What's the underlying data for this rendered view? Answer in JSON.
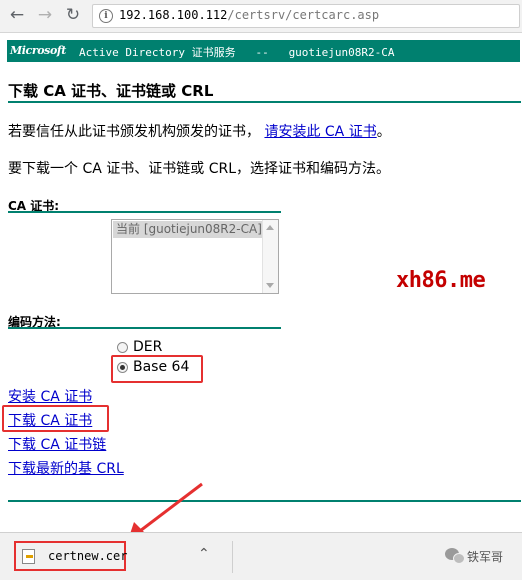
{
  "browser": {
    "url_host": "192.168.100.112",
    "url_path": "/certsrv/certcarc.asp"
  },
  "banner": {
    "brand": "Microsoft",
    "text": "Active Directory 证书服务   --   guotiejun08R2-CA"
  },
  "page": {
    "title": "下载 CA 证书、证书链或 CRL",
    "trust_text": "若要信任从此证书颁发机构颁发的证书，",
    "trust_link": "请安装此 CA 证书",
    "trust_end": "。",
    "instruction": "要下载一个 CA 证书、证书链或 CRL，选择证书和编码方法。"
  },
  "cert_section": {
    "label": "CA 证书:",
    "options": [
      "当前 [guotiejun08R2-CA]"
    ]
  },
  "encoding": {
    "label": "编码方法:",
    "options": [
      {
        "label": "DER",
        "selected": false
      },
      {
        "label": "Base 64",
        "selected": true
      }
    ]
  },
  "links": {
    "install_ca": "安装 CA 证书",
    "download_ca": "下载 CA 证书",
    "download_chain": "下载 CA 证书链",
    "download_crl": "下载最新的基 CRL"
  },
  "watermark": "xh86.me",
  "download_bar": {
    "filename": "certnew.cer",
    "account": "铁军哥"
  },
  "colors": {
    "banner_bg": "#00806f",
    "link": "#0000cc",
    "highlight": "#e53030",
    "watermark": "#c40000"
  },
  "icons": {
    "back": "arrow-left-icon",
    "forward": "arrow-right-icon",
    "reload": "reload-icon",
    "site_info": "info-icon",
    "file": "file-icon",
    "chevron": "chevron-up-icon",
    "wechat": "wechat-icon"
  }
}
